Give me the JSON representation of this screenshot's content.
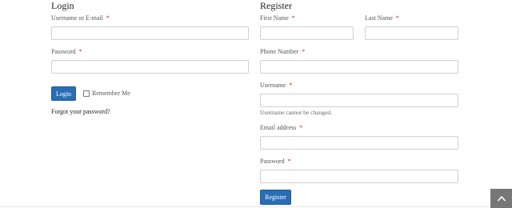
{
  "login": {
    "heading": "Login",
    "username_label": "Username or E-mail",
    "username_value": "",
    "password_label": "Password",
    "password_value": "",
    "login_button": "Login",
    "remember_label": "Remember Me",
    "remember_checked": false,
    "forgot_link": "Forgot your password?"
  },
  "register": {
    "heading": "Register",
    "first_name_label": "First Name",
    "last_name_label": "Last Name",
    "phone_label": "Phone Number",
    "username_label": "Username",
    "username_help": "Username cannot be changed.",
    "email_label": "Email address",
    "password_label": "Password",
    "register_button": "Register"
  },
  "required_marker": "*",
  "icons": {
    "scroll_top": "chevron-up-icon"
  },
  "colors": {
    "primary_button": "#2a6db3",
    "required": "#e02020",
    "scroll_top_bg": "#777777"
  }
}
